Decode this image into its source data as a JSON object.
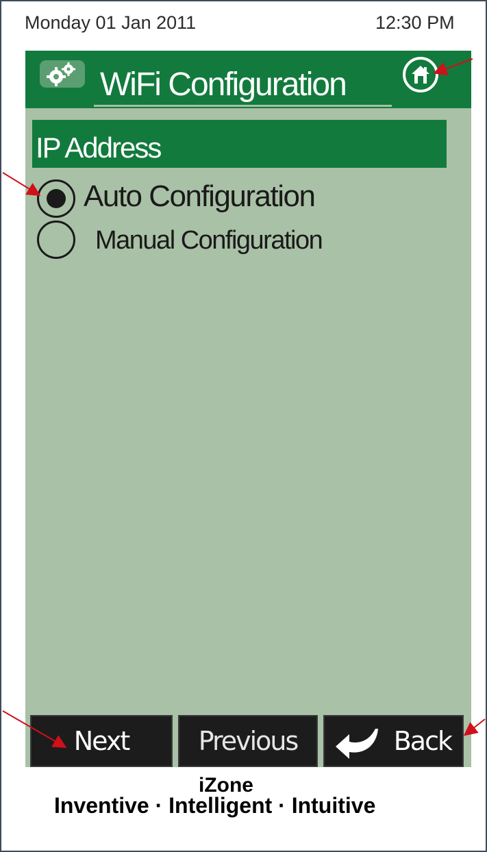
{
  "status_bar": {
    "date": "Monday 01 Jan 2011",
    "time": "12:30 PM"
  },
  "header": {
    "title": "WiFi Configuration",
    "settings_icon": "gears-icon",
    "home_icon": "home-icon"
  },
  "section": {
    "label": "IP Address"
  },
  "options": [
    {
      "label": "Auto Configuration",
      "selected": true
    },
    {
      "label": "Manual  Configuration",
      "selected": false
    }
  ],
  "buttons": {
    "next": "Next",
    "previous": "Previous",
    "back": "Back"
  },
  "branding": {
    "name": "iZone",
    "tagline": "Inventive · Intelligent · Intuitive"
  },
  "colors": {
    "header_green": "#127a3d",
    "screen_bg": "#a9c1a6",
    "button_bg": "#1c1c1c",
    "annotation_arrow": "#d0101a"
  }
}
